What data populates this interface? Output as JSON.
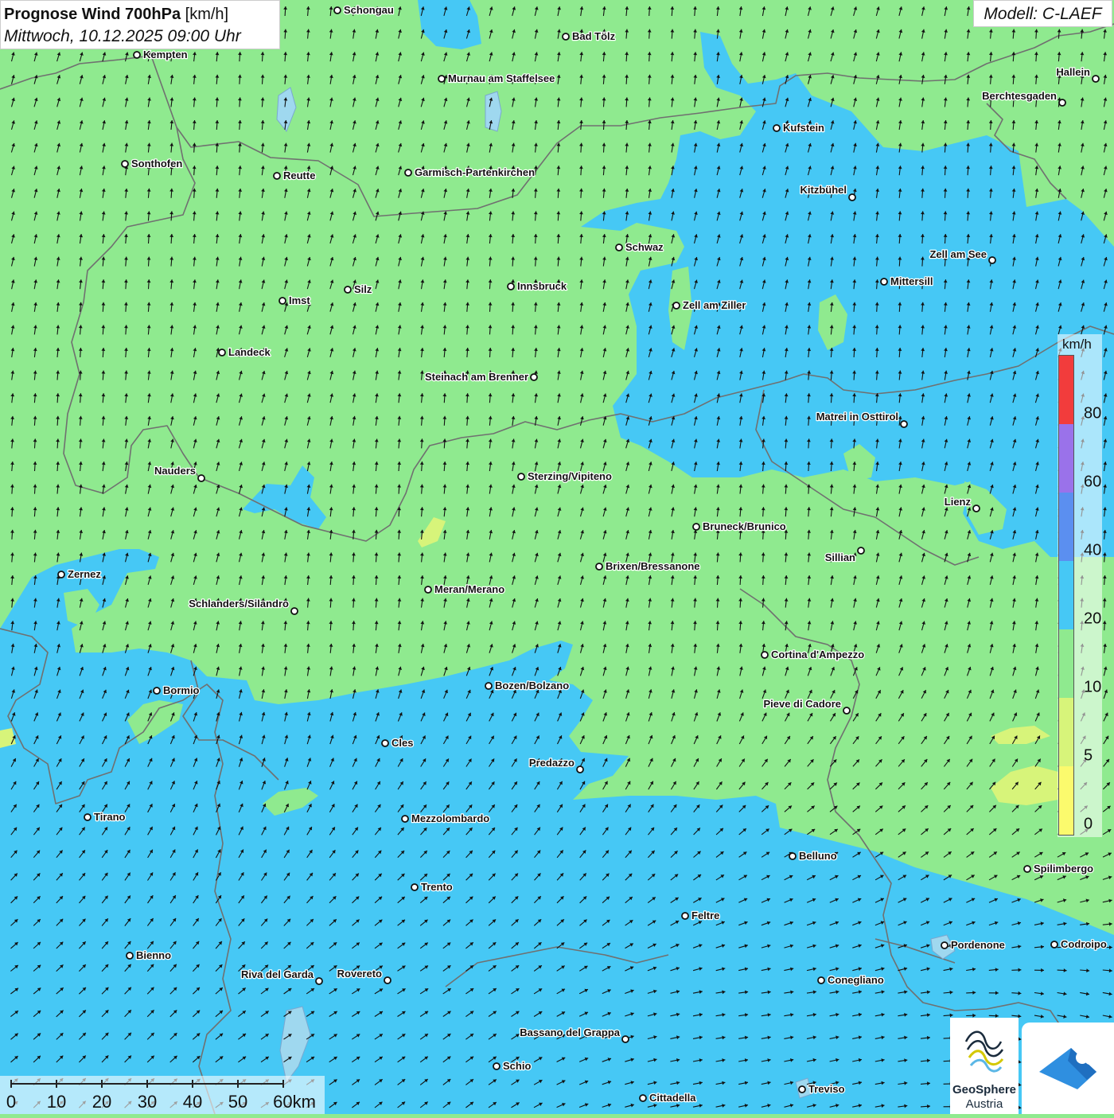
{
  "title": {
    "bold": "Prognose Wind 700hPa",
    "unit": "[km/h]",
    "datetime": "Mittwoch, 10.12.2025 09:00 Uhr"
  },
  "model_label": "Modell: C-LAEF",
  "legend": {
    "unit": "km/h",
    "ticks": [
      "0",
      "5",
      "10",
      "20",
      "40",
      "60",
      "80"
    ],
    "bins": [
      {
        "from": 0,
        "to": 5,
        "color": "#fbfa6d"
      },
      {
        "from": 5,
        "to": 10,
        "color": "#d7f47a"
      },
      {
        "from": 10,
        "to": 20,
        "color": "#8fea8f"
      },
      {
        "from": 20,
        "to": 40,
        "color": "#46c8f5"
      },
      {
        "from": 40,
        "to": 60,
        "color": "#5b8ff0"
      },
      {
        "from": 60,
        "to": 80,
        "color": "#9a72ea"
      },
      {
        "from": 80,
        "to": 100,
        "color": "#f23c3c"
      }
    ]
  },
  "colors": {
    "wind_10_20": "#8fea8f",
    "wind_20_40": "#46c8f5",
    "wind_5_10": "#d7f47a",
    "border": "#707070",
    "arrow": "#111111",
    "brand_blue": "#2f8fe0"
  },
  "scalebar": {
    "labels": [
      "0",
      "10",
      "20",
      "30",
      "40",
      "50",
      "60km"
    ]
  },
  "cities": [
    {
      "name": "Schongau",
      "label_side": "right"
    },
    {
      "name": "Bad Tölz",
      "label_side": "right"
    },
    {
      "name": "Kempten",
      "label_side": "right"
    },
    {
      "name": "Murnau am Staffelsee",
      "label_side": "right"
    },
    {
      "name": "Hallein",
      "label_side": "left"
    },
    {
      "name": "Berchtesgaden",
      "label_side": "left"
    },
    {
      "name": "Kufstein",
      "label_side": "right"
    },
    {
      "name": "Sonthofen",
      "label_side": "right"
    },
    {
      "name": "Reutte",
      "label_side": "right"
    },
    {
      "name": "Garmisch-Partenkirchen",
      "label_side": "right"
    },
    {
      "name": "Kitzbühel",
      "label_side": "left"
    },
    {
      "name": "Schwaz",
      "label_side": "right"
    },
    {
      "name": "Zell am See",
      "label_side": "left"
    },
    {
      "name": "Mittersill",
      "label_side": "right"
    },
    {
      "name": "Innsbruck",
      "label_side": "right"
    },
    {
      "name": "Silz",
      "label_side": "right"
    },
    {
      "name": "Imst",
      "label_side": "right"
    },
    {
      "name": "Zell am Ziller",
      "label_side": "right"
    },
    {
      "name": "Landeck",
      "label_side": "right"
    },
    {
      "name": "Steinach am Brenner",
      "label_side": "left"
    },
    {
      "name": "Matrei in Osttirol",
      "label_side": "left"
    },
    {
      "name": "Nauders",
      "label_side": "left"
    },
    {
      "name": "Sterzing/Vipiteno",
      "label_side": "right"
    },
    {
      "name": "Lienz",
      "label_side": "left"
    },
    {
      "name": "Bruneck/Brunico",
      "label_side": "right"
    },
    {
      "name": "Sillian",
      "label_side": "left"
    },
    {
      "name": "Brixen/Bressanone",
      "label_side": "right"
    },
    {
      "name": "Zernez",
      "label_side": "right"
    },
    {
      "name": "Meran/Merano",
      "label_side": "right"
    },
    {
      "name": "Schlanders/Silandro",
      "label_side": "left"
    },
    {
      "name": "Cortina d'Ampezzo",
      "label_side": "right"
    },
    {
      "name": "Bozen/Bolzano",
      "label_side": "right"
    },
    {
      "name": "Bormio",
      "label_side": "right"
    },
    {
      "name": "Pieve di Cadore",
      "label_side": "left"
    },
    {
      "name": "Cles",
      "label_side": "right"
    },
    {
      "name": "Predazzo",
      "label_side": "left"
    },
    {
      "name": "Tirano",
      "label_side": "right"
    },
    {
      "name": "Mezzolombardo",
      "label_side": "right"
    },
    {
      "name": "Belluno",
      "label_side": "right"
    },
    {
      "name": "Spilimbergo",
      "label_side": "right"
    },
    {
      "name": "Trento",
      "label_side": "right"
    },
    {
      "name": "Feltre",
      "label_side": "right"
    },
    {
      "name": "Pordenone",
      "label_side": "right"
    },
    {
      "name": "Codroipo",
      "label_side": "right"
    },
    {
      "name": "Bienno",
      "label_side": "right"
    },
    {
      "name": "Riva del Garda",
      "label_side": "left"
    },
    {
      "name": "Rovereto",
      "label_side": "left"
    },
    {
      "name": "Conegliano",
      "label_side": "right"
    },
    {
      "name": "Bassano del Grappa",
      "label_side": "left"
    },
    {
      "name": "Schio",
      "label_side": "right"
    },
    {
      "name": "Treviso",
      "label_side": "right"
    },
    {
      "name": "Cittadella",
      "label_side": "right"
    }
  ],
  "logos": {
    "geosphere_name": "GeoSphere",
    "geosphere_sub": "Austria"
  }
}
